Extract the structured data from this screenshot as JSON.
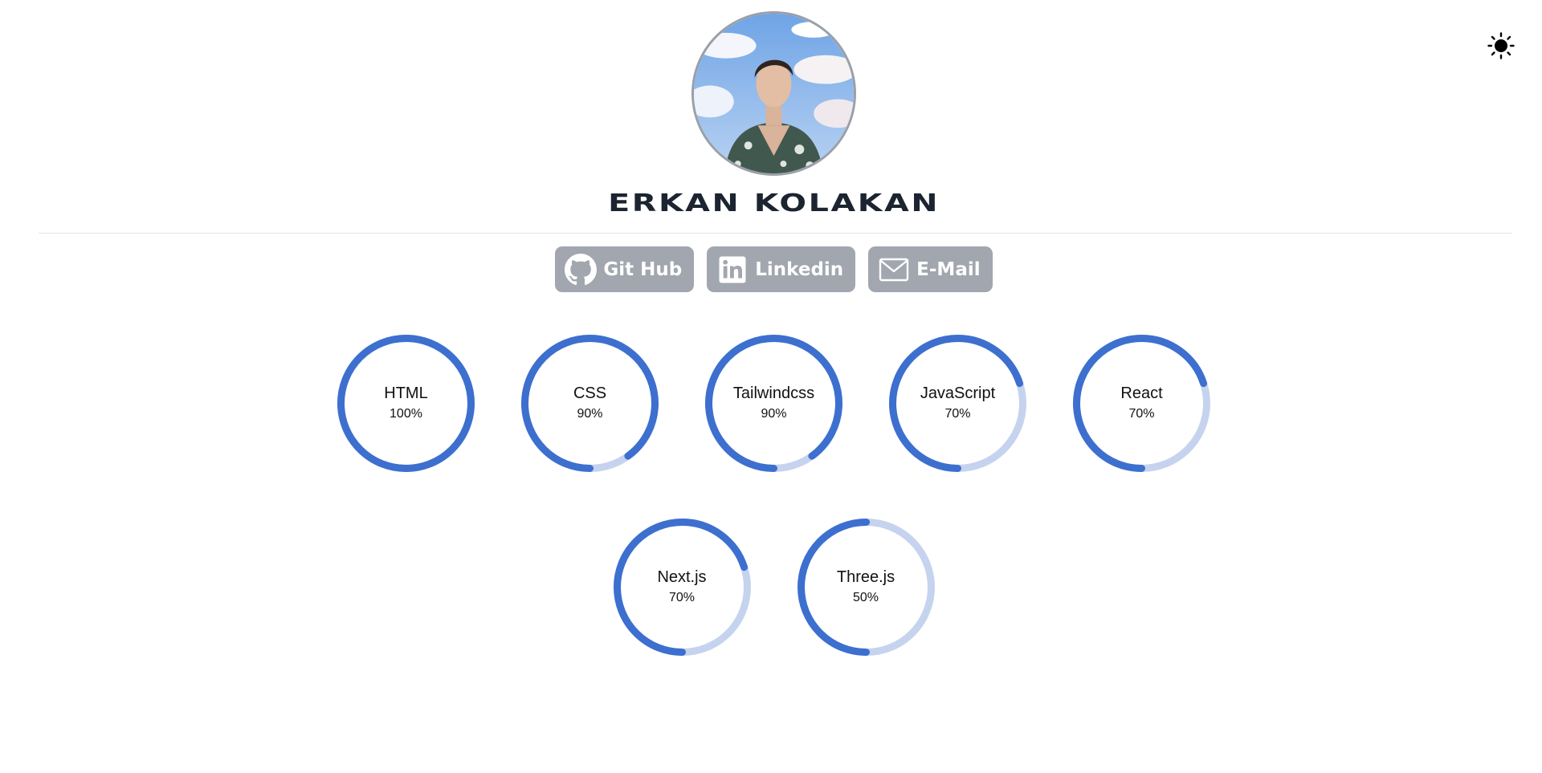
{
  "profile": {
    "name": "ERKAN KOLAKAN",
    "avatar_alt": "profile photo"
  },
  "theme_toggle": {
    "icon": "sun-icon"
  },
  "social": [
    {
      "label": "Git Hub",
      "icon": "github-icon"
    },
    {
      "label": "Linkedin",
      "icon": "linkedin-icon"
    },
    {
      "label": "E-Mail",
      "icon": "mail-icon"
    }
  ],
  "skills": [
    {
      "name": "HTML",
      "percent_label": "100%",
      "percent": 100
    },
    {
      "name": "CSS",
      "percent_label": "90%",
      "percent": 90
    },
    {
      "name": "Tailwindcss",
      "percent_label": "90%",
      "percent": 90
    },
    {
      "name": "JavaScript",
      "percent_label": "70%",
      "percent": 70
    },
    {
      "name": "React",
      "percent_label": "70%",
      "percent": 70
    },
    {
      "name": "Next.js",
      "percent_label": "70%",
      "percent": 70
    },
    {
      "name": "Three.js",
      "percent_label": "50%",
      "percent": 50
    }
  ],
  "colors": {
    "ring_fill": "#3d6fcf",
    "ring_track": "#c5d3ee",
    "button_bg": "#a1a6af",
    "name_text": "#1b2430"
  }
}
